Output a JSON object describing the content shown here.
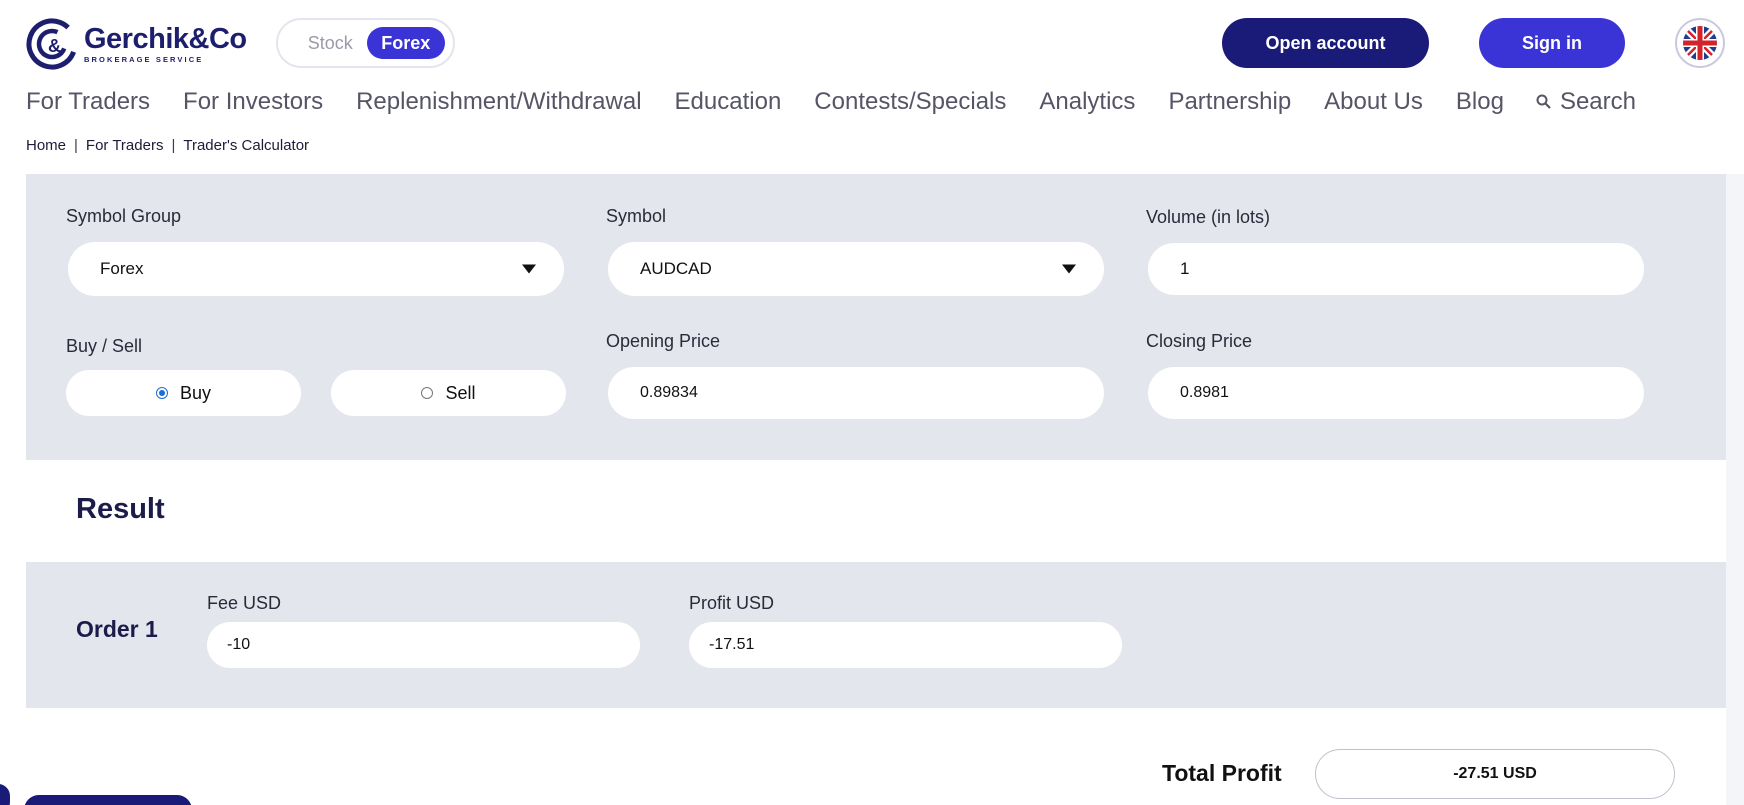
{
  "brand": {
    "name": "Gerchik&Co",
    "tagline": "BROKERAGE SERVICE"
  },
  "mode_toggle": {
    "stock_label": "Stock",
    "forex_label": "Forex",
    "selected": "Forex"
  },
  "header": {
    "open_account_label": "Open account",
    "sign_in_label": "Sign in",
    "language_icon": "uk-flag-icon"
  },
  "nav": {
    "items": [
      "For Traders",
      "For Investors",
      "Replenishment/Withdrawal",
      "Education",
      "Contests/Specials",
      "Analytics",
      "Partnership",
      "About Us",
      "Blog"
    ],
    "search_label": "Search",
    "search_icon": "search-icon"
  },
  "breadcrumb": {
    "items": [
      "Home",
      "For Traders",
      "Trader's Calculator"
    ],
    "separator": "|"
  },
  "calculator": {
    "symbol_group": {
      "label": "Symbol Group",
      "value": "Forex"
    },
    "symbol": {
      "label": "Symbol",
      "value": "AUDCAD"
    },
    "volume": {
      "label": "Volume (in lots)",
      "value": "1"
    },
    "buy_sell": {
      "label": "Buy / Sell",
      "buy_label": "Buy",
      "sell_label": "Sell",
      "selected": "Buy"
    },
    "opening_price": {
      "label": "Opening Price",
      "value": "0.89834"
    },
    "closing_price": {
      "label": "Closing Price",
      "value": "0.8981"
    }
  },
  "result": {
    "title": "Result",
    "order_label": "Order 1",
    "fee": {
      "label": "Fee USD",
      "value": "-10"
    },
    "profit": {
      "label": "Profit USD",
      "value": "-17.51"
    },
    "total_label": "Total Profit",
    "total_value": "-27.51 USD"
  },
  "colors": {
    "primary": "#3a34d6",
    "dark": "#1a1a78",
    "panel": "#e4e6ed"
  }
}
